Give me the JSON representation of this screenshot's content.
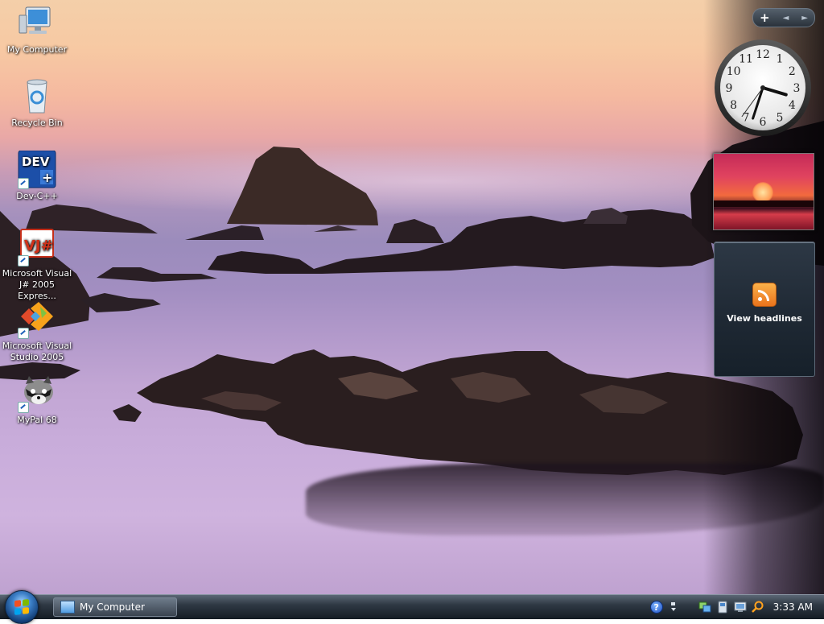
{
  "desktop_icons": [
    {
      "label": "My Computer",
      "icon": "computer-icon",
      "shortcut": false
    },
    {
      "label": "Recycle Bin",
      "icon": "recycle-bin-icon",
      "shortcut": false
    },
    {
      "label": "Dev-C++",
      "icon": "dev-cpp-icon",
      "shortcut": true
    },
    {
      "label": "Microsoft Visual J# 2005 Expres...",
      "icon": "visual-j-sharp-icon",
      "shortcut": true
    },
    {
      "label": "Microsoft Visual Studio 2005",
      "icon": "visual-studio-icon",
      "shortcut": true
    },
    {
      "label": "MyPal 68",
      "icon": "mypal-raccoon-icon",
      "shortcut": true
    }
  ],
  "gadgets": {
    "controls": {
      "add": "+",
      "prev": "◄",
      "next": "►"
    },
    "clock": {
      "numbers": [
        "12",
        "1",
        "2",
        "3",
        "4",
        "5",
        "6",
        "7",
        "8",
        "9",
        "10",
        "11"
      ],
      "hour": 3,
      "minute": 33,
      "second": 36
    },
    "feed": {
      "label": "View headlines"
    }
  },
  "taskbar": {
    "task": "My Computer",
    "clock": "3:33 AM",
    "help": "?"
  },
  "colors": {
    "flag_red": "#f25022",
    "flag_green": "#7fba00",
    "flag_blue": "#00a4ef",
    "flag_yellow": "#ffb900"
  }
}
